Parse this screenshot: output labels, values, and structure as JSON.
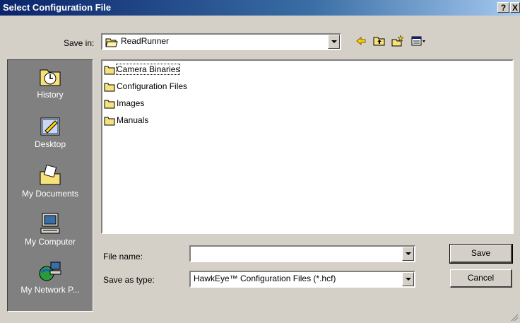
{
  "window": {
    "title": "Select Configuration File",
    "help_label": "?",
    "close_label": "X"
  },
  "save_in": {
    "label": "Save in:",
    "value": "ReadRunner"
  },
  "places": [
    {
      "label": "History",
      "icon": "history-icon"
    },
    {
      "label": "Desktop",
      "icon": "desktop-icon"
    },
    {
      "label": "My Documents",
      "icon": "my-documents-icon"
    },
    {
      "label": "My Computer",
      "icon": "my-computer-icon"
    },
    {
      "label": "My Network P...",
      "icon": "my-network-places-icon"
    }
  ],
  "files": [
    {
      "name": "Camera Binaries",
      "icon": "folder-icon"
    },
    {
      "name": "Configuration Files",
      "icon": "folder-icon"
    },
    {
      "name": "Images",
      "icon": "folder-icon"
    },
    {
      "name": "Manuals",
      "icon": "folder-icon"
    }
  ],
  "file_name": {
    "label": "File name:",
    "value": ""
  },
  "save_as_type": {
    "label": "Save as type:",
    "value": "HawkEye™ Configuration Files (*.hcf)"
  },
  "buttons": {
    "save": "Save",
    "cancel": "Cancel"
  }
}
